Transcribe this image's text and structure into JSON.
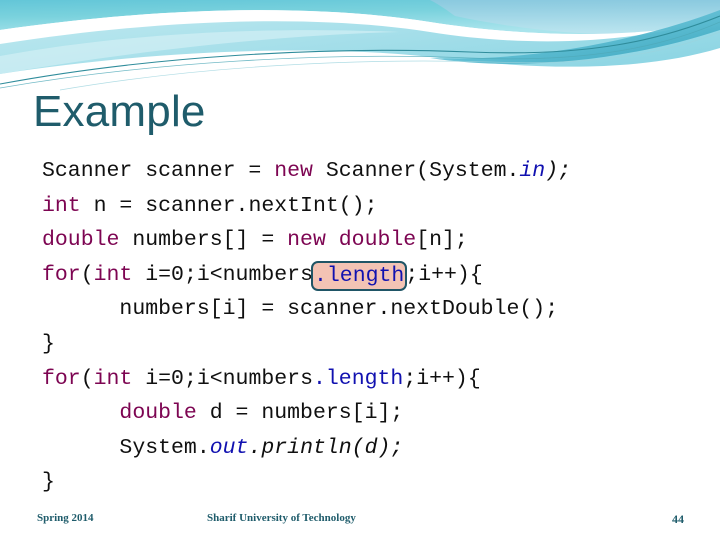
{
  "slide": {
    "title": "Example",
    "theme": {
      "title_color": "#1f5c6b",
      "accent_cyan": "#6fd5e0",
      "accent_teal": "#2a8fa0",
      "highlight_fill": "#f3c3b4",
      "highlight_border": "#1f5566",
      "keyword_color": "#7d0552",
      "field_color": "#1111b0",
      "code_color": "#101010"
    }
  },
  "code": {
    "language": "java",
    "lines": [
      {
        "indent": 0,
        "text": "Scanner scanner = new Scanner(System.in);",
        "tokens": [
          {
            "t": "Scanner scanner = ",
            "c": "plain"
          },
          {
            "t": "new",
            "c": "kw"
          },
          {
            "t": " Scanner(System.",
            "c": "plain"
          },
          {
            "t": "in",
            "c": "field ital"
          },
          {
            "t": ");",
            "c": "plain ital"
          }
        ]
      },
      {
        "indent": 0,
        "text": "int n = scanner.nextInt();",
        "tokens": [
          {
            "t": "int",
            "c": "kw"
          },
          {
            "t": " n = scanner.nextInt();",
            "c": "plain"
          }
        ]
      },
      {
        "indent": 0,
        "text": "double numbers[] = new double[n];",
        "tokens": [
          {
            "t": "double",
            "c": "kw"
          },
          {
            "t": " numbers[] = ",
            "c": "plain"
          },
          {
            "t": "new double",
            "c": "kw"
          },
          {
            "t": "[n];",
            "c": "plain"
          }
        ]
      },
      {
        "indent": 0,
        "text": "for(int i=0;i<numbers.length;i++){",
        "highlight": ".length",
        "tokens": [
          {
            "t": "for",
            "c": "kw"
          },
          {
            "t": "(",
            "c": "plain"
          },
          {
            "t": "int",
            "c": "kw"
          },
          {
            "t": " i=0;i<numbers",
            "c": "plain"
          },
          {
            "t": ".length",
            "c": "field",
            "box": true
          },
          {
            "t": ";i++){",
            "c": "plain"
          }
        ]
      },
      {
        "indent": 1,
        "text": "numbers[i] = scanner.nextDouble();",
        "tokens": [
          {
            "t": "numbers[i] = scanner.nextDouble();",
            "c": "plain"
          }
        ]
      },
      {
        "indent": 0,
        "text": "}",
        "tokens": [
          {
            "t": "}",
            "c": "plain"
          }
        ]
      },
      {
        "indent": 0,
        "text": "for(int i=0;i<numbers.length;i++){",
        "tokens": [
          {
            "t": "for",
            "c": "kw"
          },
          {
            "t": "(",
            "c": "plain"
          },
          {
            "t": "int",
            "c": "kw"
          },
          {
            "t": " i=0;i<numbers",
            "c": "plain"
          },
          {
            "t": ".length",
            "c": "field"
          },
          {
            "t": ";i++){",
            "c": "plain"
          }
        ]
      },
      {
        "indent": 1,
        "text": "double d = numbers[i];",
        "tokens": [
          {
            "t": "double",
            "c": "kw"
          },
          {
            "t": " d = numbers[i];",
            "c": "plain"
          }
        ]
      },
      {
        "indent": 1,
        "text": "System.out.println(d);",
        "tokens": [
          {
            "t": "System.",
            "c": "plain"
          },
          {
            "t": "out",
            "c": "field ital"
          },
          {
            "t": ".println(d);",
            "c": "plain ital"
          }
        ]
      },
      {
        "indent": 0,
        "text": "}",
        "tokens": [
          {
            "t": "}",
            "c": "plain"
          }
        ]
      }
    ]
  },
  "footer": {
    "left": "Spring 2014",
    "center": "Sharif University of Technology",
    "page_number": "44"
  }
}
